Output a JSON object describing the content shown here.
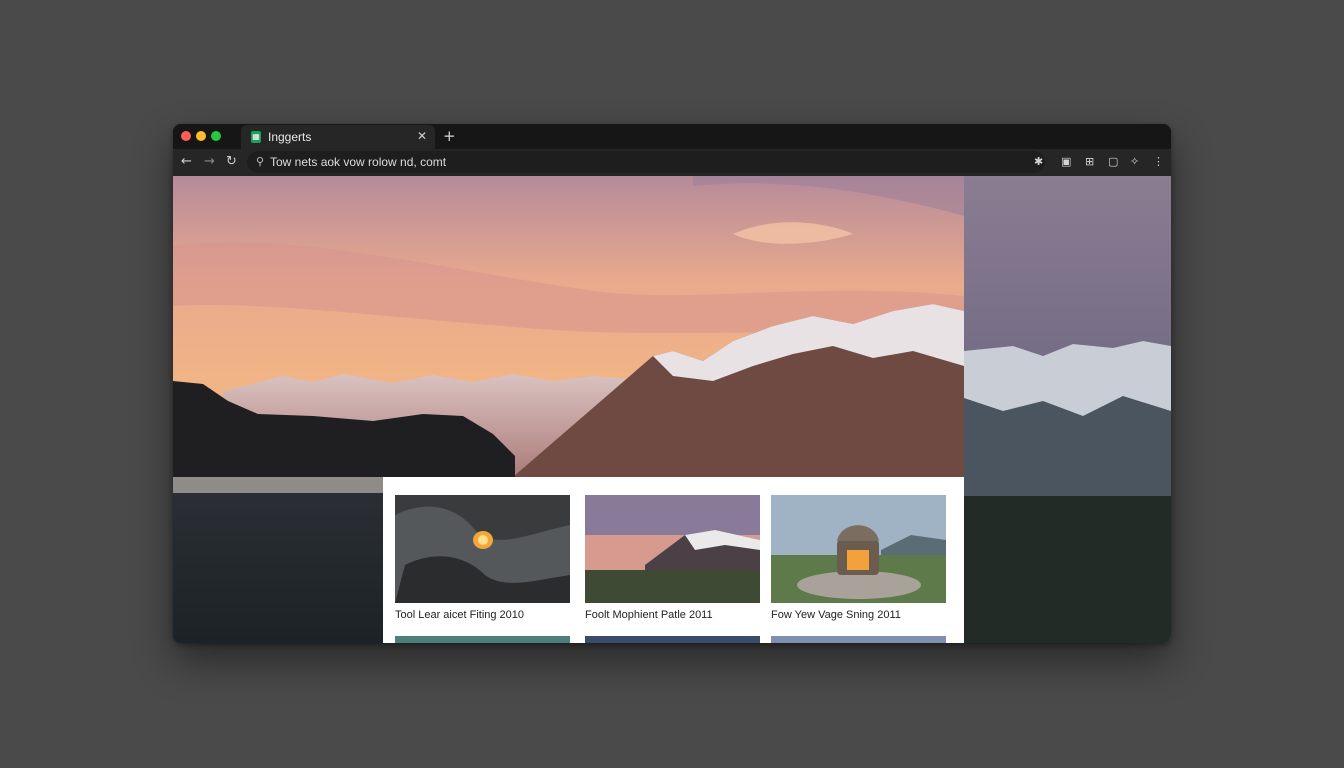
{
  "browser": {
    "tab": {
      "title": "Inggerts",
      "favicon": "spreadsheet-icon"
    },
    "new_tab_label": "+",
    "close_label": "✕",
    "url": "Tow nets aok vow rolow nd, comt",
    "toolbar_icons": [
      "star-icon",
      "reading-list-icon",
      "tab-search-icon",
      "sidebar-icon",
      "extensions-icon",
      "menu-icon"
    ]
  },
  "gallery": {
    "cards": [
      {
        "caption": "Tool Lear aicet Fiting 2010"
      },
      {
        "caption": "Foolt Mophient Patle 2011"
      },
      {
        "caption": "Fow Yew Vage Sning 2011"
      }
    ]
  },
  "colors": {
    "page_background": "#4a4a4a",
    "tab_strip": "#161616",
    "toolbar": "#262626",
    "close_dot": "#ff5f57",
    "minimize_dot": "#febc2e",
    "maximize_dot": "#28c840"
  }
}
